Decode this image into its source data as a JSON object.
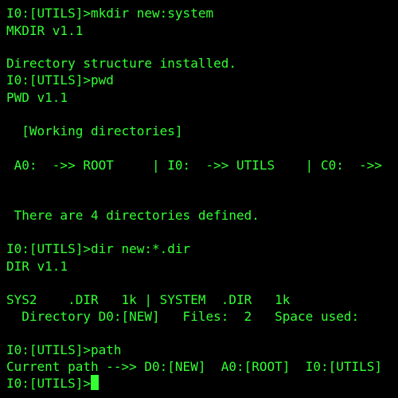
{
  "colors": {
    "background": "#000000",
    "text": "#33ff33",
    "cursor": "#33ff33"
  },
  "terminal": {
    "lines": [
      "I0:[UTILS]>mkdir new:system",
      "MKDIR v1.1",
      "Directory structure installed.",
      "I0:[UTILS]>pwd",
      "PWD v1.1",
      "  [Working directories]",
      " A0:  ->> ROOT     | I0:  ->> UTILS    | C0:  ->>",
      " There are 4 directories defined.",
      "I0:[UTILS]>dir new:*.dir",
      "DIR v1.1",
      "SYS2    .DIR   1k | SYSTEM  .DIR   1k",
      "  Directory D0:[NEW]   Files:  2   Space used:",
      "I0:[UTILS]>path",
      "Current path -->> D0:[NEW]  A0:[ROOT]  I0:[UTILS]",
      "I0:[UTILS]>"
    ]
  }
}
